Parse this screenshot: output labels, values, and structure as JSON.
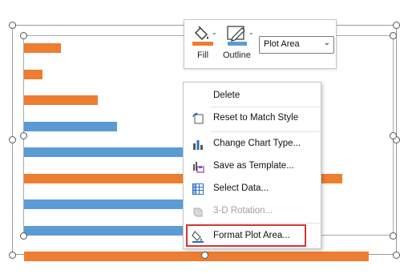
{
  "colors": {
    "orange": "#ED7D31",
    "blue": "#5B9BD5",
    "highlight": "#D23636"
  },
  "bars": [
    {
      "series": "orange",
      "value": 0.1
    },
    {
      "series": "orange",
      "value": 0.05
    },
    {
      "series": "orange",
      "value": 0.2
    },
    {
      "series": "blue",
      "value": 0.25
    },
    {
      "series": "blue",
      "value": 0.45
    },
    {
      "series": "orange",
      "value": 0.86
    },
    {
      "series": "blue",
      "value": 0.45
    },
    {
      "series": "blue",
      "value": 0.45
    },
    {
      "series": "orange",
      "value": 0.93
    }
  ],
  "ribbon": {
    "fill_label": "Fill",
    "outline_label": "Outline",
    "element_select": "Plot Area"
  },
  "menu": {
    "items": [
      {
        "label": "Delete",
        "icon": "none",
        "enabled": true
      },
      {
        "label": "Reset to Match Style",
        "icon": "reset-style-icon",
        "enabled": true
      },
      {
        "label": "Change Chart Type...",
        "icon": "chart-type-icon",
        "enabled": true
      },
      {
        "label": "Save as Template...",
        "icon": "save-template-icon",
        "enabled": true
      },
      {
        "label": "Select Data...",
        "icon": "select-data-icon",
        "enabled": true
      },
      {
        "label": "3-D Rotation...",
        "icon": "rotation-icon",
        "enabled": false
      },
      {
        "label": "Format Plot Area...",
        "icon": "format-plot-area-icon",
        "enabled": true
      }
    ]
  }
}
